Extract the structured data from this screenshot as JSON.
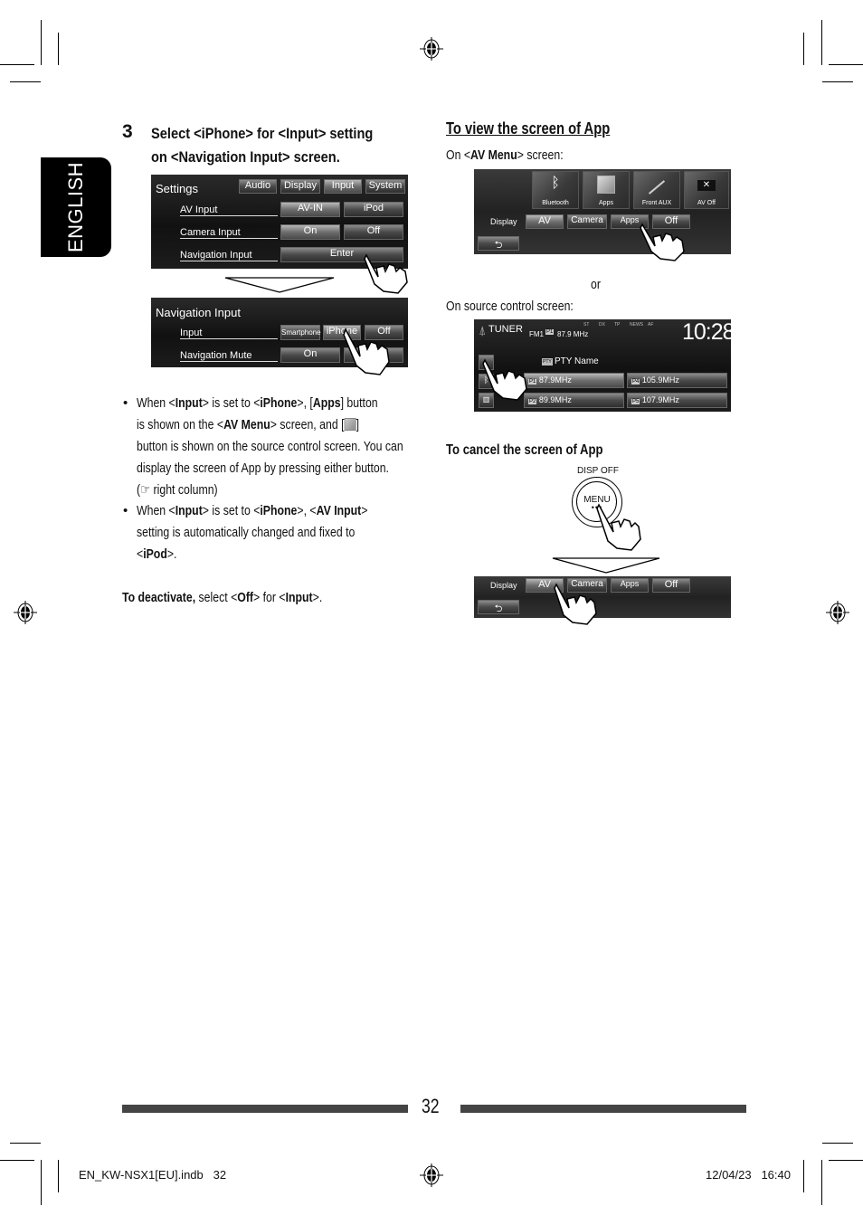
{
  "language_tab": "ENGLISH",
  "step": {
    "number": "3",
    "title_line1": "Select <iPhone> for <Input> setting",
    "title_line2": "on <Navigation Input> screen."
  },
  "settings_screen": {
    "title": "Settings",
    "tabs": [
      "Audio",
      "Display",
      "Input",
      "System"
    ],
    "selected_tab": "Input",
    "rows": [
      {
        "label": "AV Input",
        "options": [
          "AV-IN",
          "iPod"
        ]
      },
      {
        "label": "Camera Input",
        "options": [
          "On",
          "Off"
        ]
      },
      {
        "label": "Navigation Input",
        "options": [
          "Enter"
        ]
      }
    ]
  },
  "nav_input_screen": {
    "title": "Navigation Input",
    "rows": [
      {
        "label": "Input",
        "options": [
          "Smartphone",
          "iPhone",
          "Off"
        ]
      },
      {
        "label": "Navigation Mute",
        "options": [
          "On",
          ""
        ]
      }
    ]
  },
  "notes": [
    {
      "lines": [
        [
          "When <",
          {
            "b": "Input"
          },
          "> is set to <",
          {
            "b": "iPhone"
          },
          ">, [",
          {
            "b": "Apps"
          },
          "] button"
        ],
        [
          "is shown on the <",
          {
            "b": "AV Menu"
          },
          "> screen, and [",
          {
            "icon": "apps-icon"
          },
          "]"
        ],
        [
          "button is shown on the source control screen. You can"
        ],
        [
          "display the screen of App by pressing either button."
        ],
        [
          "(☞ right column)"
        ]
      ]
    },
    {
      "lines": [
        [
          "When <",
          {
            "b": "Input"
          },
          "> is set to <",
          {
            "b": "iPhone"
          },
          ">, <",
          {
            "b": "AV Input"
          },
          ">"
        ],
        [
          "setting is automatically changed and fixed to"
        ],
        [
          "<",
          {
            "b": "iPod"
          },
          ">."
        ]
      ]
    }
  ],
  "deactivate": {
    "bold": "To deactivate,",
    "text1": " select <",
    "b1": "Off",
    "text2": "> for <",
    "b2": "Input",
    "text3": ">."
  },
  "view_section": {
    "heading": "To view the screen of App",
    "on_av_menu_pre": "On <",
    "on_av_menu_bold": "AV Menu",
    "on_av_menu_post": "> screen:",
    "or": "or",
    "on_source": "On source control screen:"
  },
  "av_menu_screen": {
    "tiles": [
      {
        "label": "Bluetooth",
        "icon": "bluetooth-icon"
      },
      {
        "label": "Apps",
        "icon": "apps-icon"
      },
      {
        "label": "Front AUX",
        "icon": "aux-cable-icon"
      },
      {
        "label": "AV Off",
        "icon": "close-icon"
      }
    ],
    "display_label": "Display",
    "display_buttons": [
      "AV",
      "Camera",
      "Apps",
      "Off"
    ],
    "selected": "AV"
  },
  "tuner_screen": {
    "source": "TUNER",
    "band": "FM1",
    "preset_badge": "P1",
    "frequency": "87.9 MHz",
    "indicators": [
      "ST",
      "DX",
      "TP",
      "NEWS",
      "AF"
    ],
    "clock": "10:28",
    "pty": "PTY Name",
    "pty_badge": "PTY",
    "presets": [
      {
        "badge": "P1",
        "freq": "87.9MHz"
      },
      {
        "badge": "P4",
        "freq": "105.9MHz"
      },
      {
        "badge": "P2",
        "freq": "89.9MHz"
      },
      {
        "badge": "P5",
        "freq": "107.9MHz"
      }
    ]
  },
  "cancel_section": {
    "heading": "To cancel the screen of App",
    "button_top_label": "DISP OFF",
    "button_label": "MENU"
  },
  "display_bar_screen": {
    "display_label": "Display",
    "buttons": [
      "AV",
      "Camera",
      "Apps",
      "Off"
    ],
    "selected": "AV"
  },
  "footer": {
    "page_number": "32",
    "file": "EN_KW-NSX1[EU].indb   32",
    "date": "12/04/23   16:40"
  }
}
